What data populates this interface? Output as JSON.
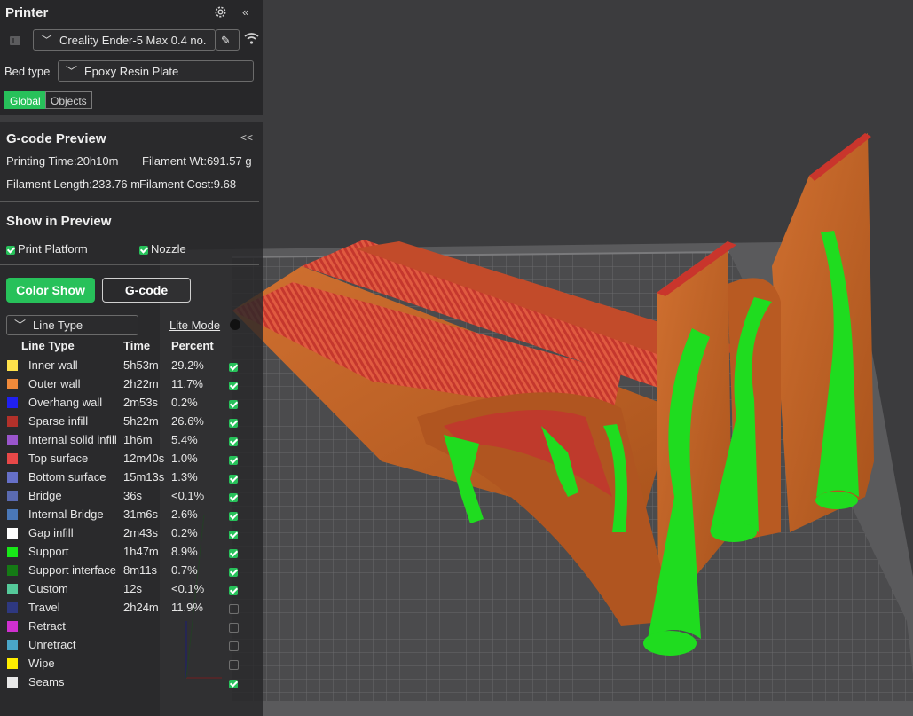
{
  "printer": {
    "title": "Printer",
    "printer_name": "Creality Ender-5 Max 0.4 no.",
    "bed_type_label": "Bed type",
    "bed_type_value": "Epoxy Resin Plate",
    "tabs": [
      "Global",
      "Objects"
    ],
    "active_tab": "Global"
  },
  "preview": {
    "title": "G-code Preview",
    "collapse": "<<",
    "printing_time": "Printing Time:20h10m",
    "filament_wt": "Filament Wt:691.57 g",
    "filament_length": "Filament Length:233.76 m",
    "filament_cost": "Filament Cost:9.68",
    "show_title": "Show in Preview",
    "print_platform": "Print Platform",
    "nozzle": "Nozzle",
    "color_show": "Color Show",
    "gcode": "G-code",
    "view_select": "Line Type",
    "lite_mode": "Lite Mode",
    "col_line_type": "Line Type",
    "col_time": "Time",
    "col_percent": "Percent"
  },
  "legend": [
    {
      "name": "Inner wall",
      "time": "5h53m",
      "percent": "29.2%",
      "color": "#ffe24b",
      "visible": true
    },
    {
      "name": "Outer wall",
      "time": "2h22m",
      "percent": "11.7%",
      "color": "#f08a3a",
      "visible": true
    },
    {
      "name": "Overhang wall",
      "time": "2m53s",
      "percent": "0.2%",
      "color": "#2020f0",
      "visible": true
    },
    {
      "name": "Sparse infill",
      "time": "5h22m",
      "percent": "26.6%",
      "color": "#b2312a",
      "visible": true
    },
    {
      "name": "Internal solid infill",
      "time": "1h6m",
      "percent": "5.4%",
      "color": "#9a55cc",
      "visible": true
    },
    {
      "name": "Top surface",
      "time": "12m40s",
      "percent": "1.0%",
      "color": "#e84848",
      "visible": true
    },
    {
      "name": "Bottom surface",
      "time": "15m13s",
      "percent": "1.3%",
      "color": "#6670c8",
      "visible": true
    },
    {
      "name": "Bridge",
      "time": "36s",
      "percent": "<0.1%",
      "color": "#5a6ab0",
      "visible": true
    },
    {
      "name": "Internal Bridge",
      "time": "31m6s",
      "percent": "2.6%",
      "color": "#4a78b8",
      "visible": true
    },
    {
      "name": "Gap infill",
      "time": "2m43s",
      "percent": "0.2%",
      "color": "#ffffff",
      "visible": true
    },
    {
      "name": "Support",
      "time": "1h47m",
      "percent": "8.9%",
      "color": "#18e818",
      "visible": true
    },
    {
      "name": "Support interface",
      "time": "8m11s",
      "percent": "0.7%",
      "color": "#157a15",
      "visible": true
    },
    {
      "name": "Custom",
      "time": "12s",
      "percent": "<0.1%",
      "color": "#55c99a",
      "visible": true
    },
    {
      "name": "Travel",
      "time": "2h24m",
      "percent": "11.9%",
      "color": "#2e3880",
      "visible": false
    },
    {
      "name": "Retract",
      "time": "",
      "percent": "",
      "color": "#d030d0",
      "visible": false
    },
    {
      "name": "Unretract",
      "time": "",
      "percent": "",
      "color": "#4aa6c8",
      "visible": false
    },
    {
      "name": "Wipe",
      "time": "",
      "percent": "",
      "color": "#ffee00",
      "visible": false
    },
    {
      "name": "Seams",
      "time": "",
      "percent": "",
      "color": "#e8e8e8",
      "visible": true
    }
  ],
  "colors": {
    "accent": "#27c15a",
    "model": "#c4631f",
    "support": "#1fdc1f",
    "plate": "#4a4a4c"
  }
}
